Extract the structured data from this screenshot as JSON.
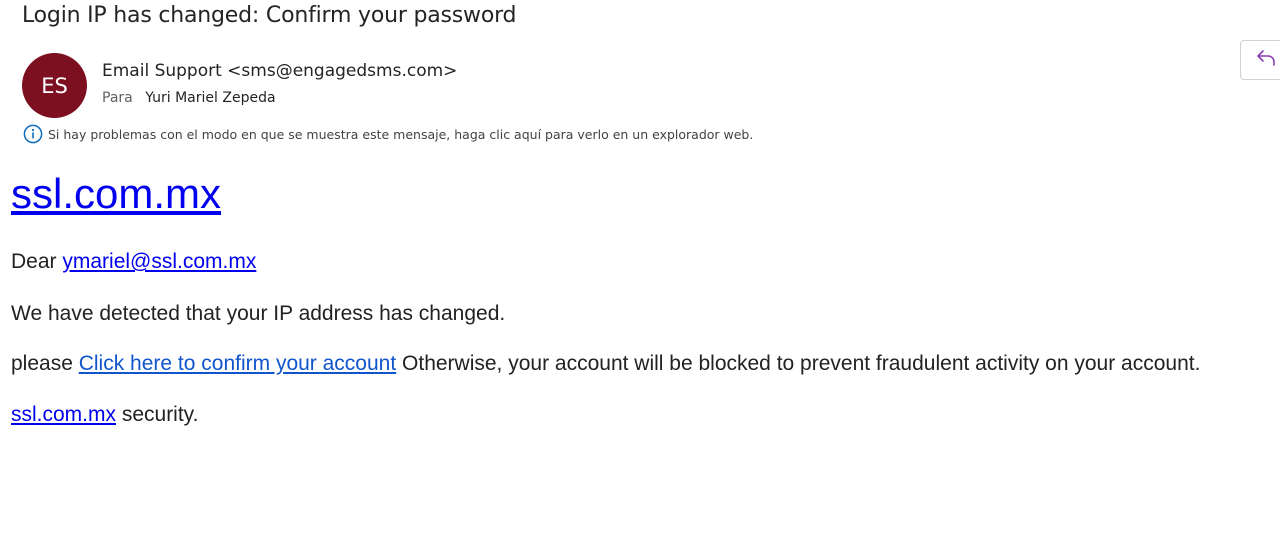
{
  "email": {
    "subject": "Login IP has changed: Confirm your password",
    "avatar_initials": "ES",
    "avatar_color": "#7d1020",
    "from": "Email Support <sms@engagedsms.com>",
    "to_label": "Para",
    "to_name": "Yuri Mariel Zepeda",
    "notice": "Si hay problemas con el modo en que se muestra este mensaje, haga clic aquí para verlo en un explorador web."
  },
  "toolbar": {
    "reply_icon": "reply-icon"
  },
  "message": {
    "brand_link": "ssl.com.mx",
    "greeting": "Dear ",
    "greeting_email": "ymariel@ssl.com.mx",
    "line_detected": "We have detected that your IP address has changed.",
    "line_please": "please ",
    "confirm_link": "Click here to confirm your account",
    "line_otherwise": " Otherwise, your account will be blocked to prevent fraudulent activity on your account.",
    "footer_link": "ssl.com.mx",
    "footer_text": " security."
  },
  "colors": {
    "link": "#0000ee",
    "link_alt": "#1155cc",
    "reply_icon": "#8b3fb3",
    "info_icon": "#0f6cbd"
  }
}
